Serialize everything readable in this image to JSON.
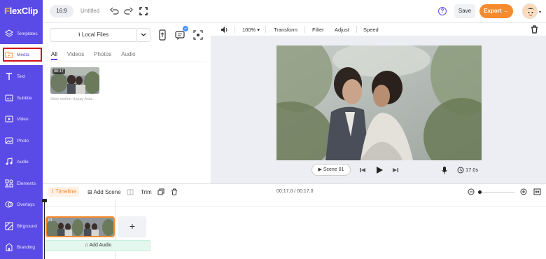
{
  "app": {
    "logo": "FlexClip"
  },
  "sidebar": {
    "items": [
      {
        "label": "Templates",
        "icon": "layers-icon"
      },
      {
        "label": "Media",
        "icon": "folder-media-icon",
        "active": true
      },
      {
        "label": "Text",
        "icon": "text-icon"
      },
      {
        "label": "Subtitle",
        "icon": "subtitle-icon"
      },
      {
        "label": "Video",
        "icon": "video-icon"
      },
      {
        "label": "Photo",
        "icon": "photo-icon"
      },
      {
        "label": "Audio",
        "icon": "music-icon"
      },
      {
        "label": "Elements",
        "icon": "elements-icon"
      },
      {
        "label": "Overlays",
        "icon": "overlays-icon"
      },
      {
        "label": "BKground",
        "icon": "background-icon"
      },
      {
        "label": "Branding",
        "icon": "branding-icon"
      }
    ]
  },
  "topbar": {
    "ratio": "16:9",
    "title": "Untitled",
    "save_label": "Save",
    "export_label": "Export →",
    "help": "?"
  },
  "media_panel": {
    "local_files_label": "Local Files",
    "ai_badge": "AI",
    "tabs": [
      "All",
      "Videos",
      "Photos",
      "Audio"
    ],
    "active_tab": "All",
    "thumb": {
      "duration": "00:17",
      "caption": "Slow motion Happy Asia..."
    }
  },
  "editor_toolbar": {
    "zoom": "100%",
    "items": [
      "Transform",
      "Filter",
      "Adjust",
      "Speed"
    ]
  },
  "preview": {
    "scene_label": "Scene 01",
    "duration": "17.0s"
  },
  "timeline": {
    "timeline_label": "Timeline",
    "add_scene_label": "Add Scene",
    "trim_label": "Trim",
    "time_display": "00:17.0 / 00:17.0",
    "clip_label": "01",
    "add_audio_label": "Add Audio",
    "add_scene_plus": "+",
    "zoom_level": 0
  },
  "colors": {
    "sidebar": "#5b4be6",
    "accent_orange": "#f68a2d",
    "highlight_red": "#d0121b"
  }
}
